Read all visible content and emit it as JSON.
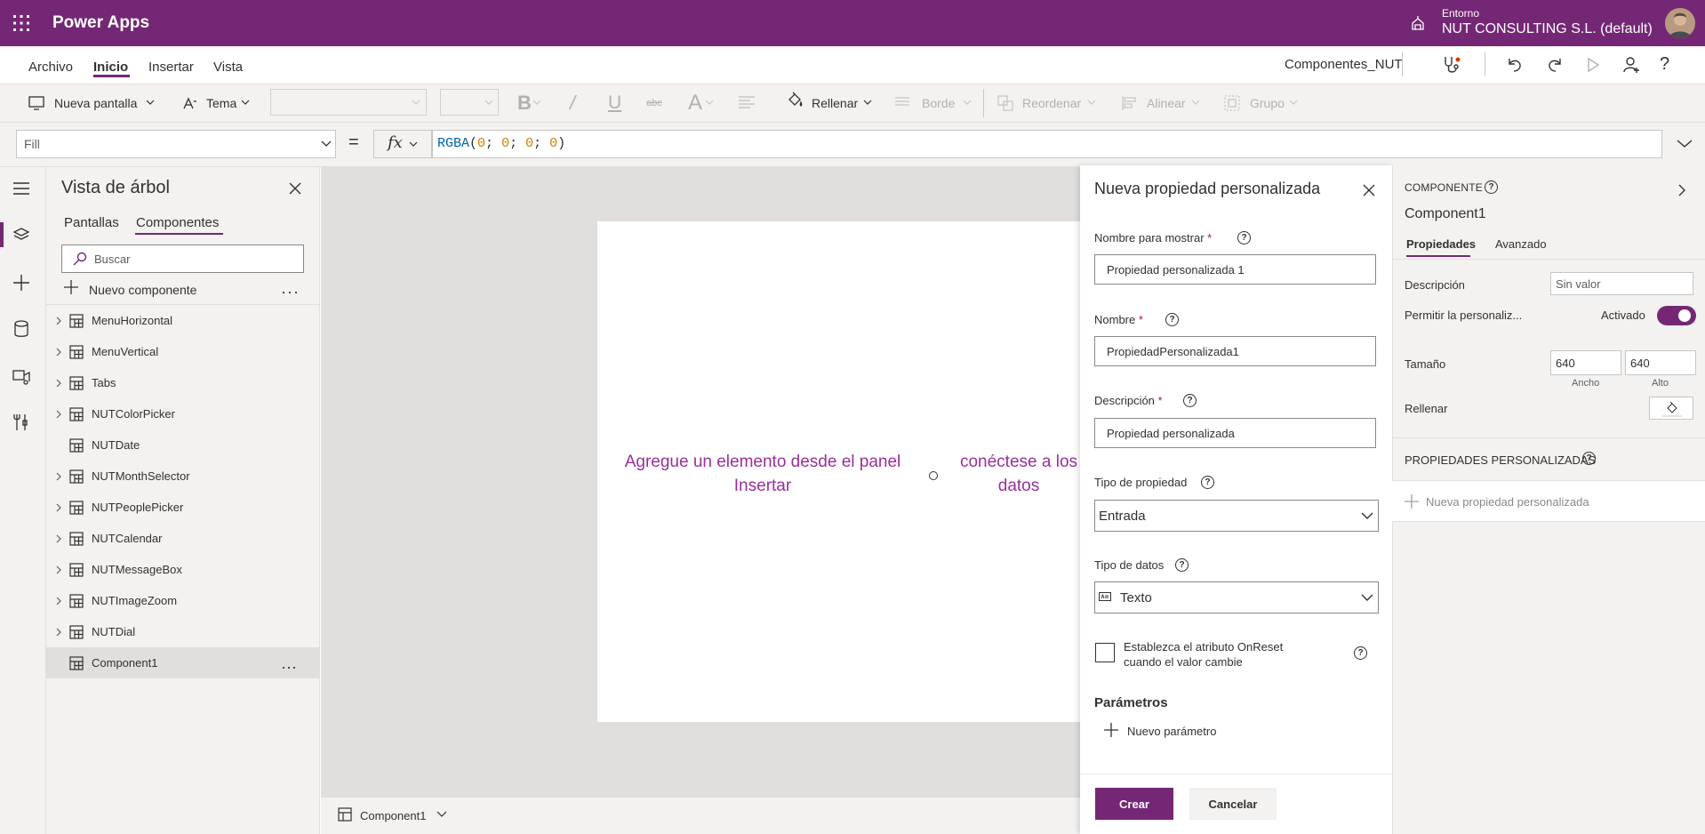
{
  "app": {
    "title": "Power Apps",
    "env_label": "Entorno",
    "env_name": "NUT CONSULTING S.L. (default)",
    "app_name": "Componentes_NUT"
  },
  "menu": {
    "items": [
      "Archivo",
      "Inicio",
      "Insertar",
      "Vista"
    ],
    "active": "Inicio"
  },
  "ribbon": {
    "new_screen": "Nueva pantalla",
    "theme": "Tema",
    "fill": "Rellenar",
    "border": "Borde",
    "reorder": "Reordenar",
    "align": "Alinear",
    "group": "Grupo"
  },
  "formula": {
    "property": "Fill",
    "fx": "fx",
    "fn": "RGBA",
    "args": [
      "0",
      "0",
      "0",
      "0"
    ],
    "open": "(",
    "sep": "; ",
    "close": ")"
  },
  "tree": {
    "title": "Vista de árbol",
    "tabs": [
      "Pantallas",
      "Componentes"
    ],
    "active_tab": "Componentes",
    "search_placeholder": "Buscar",
    "new_component": "Nuevo componente",
    "items": [
      {
        "label": "MenuHorizontal",
        "expandable": true
      },
      {
        "label": "MenuVertical",
        "expandable": true
      },
      {
        "label": "Tabs",
        "expandable": true
      },
      {
        "label": "NUTColorPicker",
        "expandable": true
      },
      {
        "label": "NUTDate",
        "expandable": false
      },
      {
        "label": "NUTMonthSelector",
        "expandable": true
      },
      {
        "label": "NUTPeoplePicker",
        "expandable": true
      },
      {
        "label": "NUTCalendar",
        "expandable": true
      },
      {
        "label": "NUTMessageBox",
        "expandable": true
      },
      {
        "label": "NUTImageZoom",
        "expandable": true
      },
      {
        "label": "NUTDial",
        "expandable": true
      },
      {
        "label": "Component1",
        "expandable": false,
        "selected": true
      }
    ]
  },
  "canvas": {
    "msg_left": "Agregue un elemento desde el panel Insertar",
    "msg_right": "conéctese a los datos",
    "bottom_label": "Component1"
  },
  "dialog": {
    "title": "Nueva propiedad personalizada",
    "display_name_label": "Nombre para mostrar",
    "display_name_value": "Propiedad personalizada 1",
    "name_label": "Nombre",
    "name_value": "PropiedadPersonalizada1",
    "description_label": "Descripción",
    "description_value": "Propiedad personalizada",
    "required_mark": "*",
    "property_type_label": "Tipo de propiedad",
    "property_type_value": "Entrada",
    "data_type_label": "Tipo de datos",
    "data_type_value": "Texto",
    "onreset_label": "Establezca el atributo OnReset cuando el valor cambie",
    "onreset_checked": false,
    "params_title": "Parámetros",
    "new_param": "Nuevo parámetro",
    "create": "Crear",
    "cancel": "Cancelar"
  },
  "right_panel": {
    "header": "COMPONENTE",
    "component_name": "Component1",
    "tabs": [
      "Propiedades",
      "Avanzado"
    ],
    "active_tab": "Propiedades",
    "description_label": "Descripción",
    "description_placeholder": "Sin valor",
    "customize_label": "Permitir la personaliz...",
    "customize_state": "Activado",
    "customize_on": true,
    "size_label": "Tamaño",
    "width_value": "640",
    "height_value": "640",
    "width_sub": "Ancho",
    "height_sub": "Alto",
    "fill_label": "Rellenar",
    "custom_props_title": "PROPIEDADES PERSONALIZADAS",
    "new_custom_prop": "Nueva propiedad personalizada"
  },
  "colors": {
    "brand": "#742774",
    "canvas_text": "#9b2f9b",
    "panel_bg": "#f3f2f1"
  }
}
